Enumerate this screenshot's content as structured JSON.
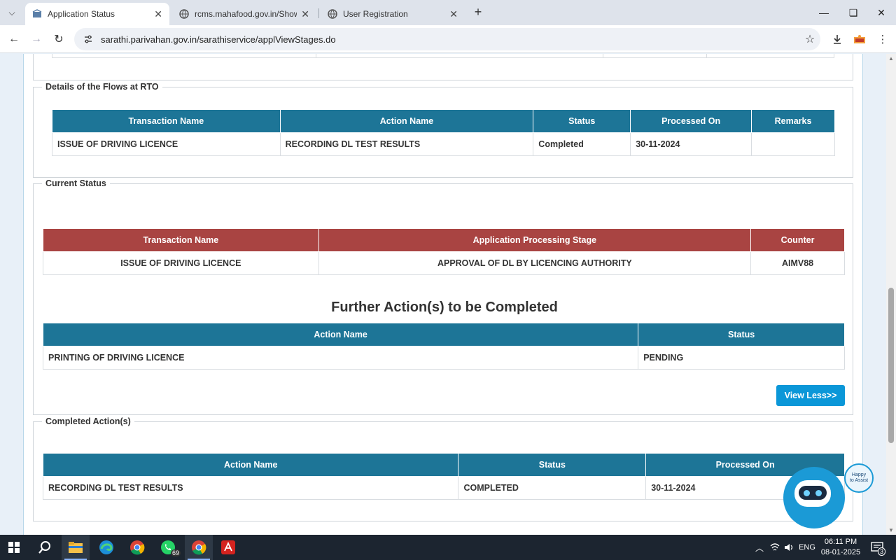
{
  "browser": {
    "tabs": [
      {
        "title": "Application Status",
        "active": true
      },
      {
        "title": "rcms.mahafood.gov.in/Show_Re",
        "active": false
      },
      {
        "title": "User Registration",
        "active": false
      }
    ],
    "url": "sarathi.parivahan.gov.in/sarathiservice/applViewStages.do"
  },
  "flows": {
    "legend": "Details of the Flows at RTO",
    "headers": [
      "Transaction Name",
      "Action Name",
      "Status",
      "Processed On",
      "Remarks"
    ],
    "rows": [
      [
        "ISSUE OF DRIVING LICENCE",
        "RECORDING DL TEST RESULTS",
        "Completed",
        "30-11-2024",
        ""
      ]
    ]
  },
  "current": {
    "legend": "Current Status",
    "headers": [
      "Transaction Name",
      "Application Processing Stage",
      "Counter"
    ],
    "rows": [
      [
        "ISSUE OF DRIVING LICENCE",
        "APPROVAL OF DL BY LICENCING AUTHORITY",
        "AIMV88"
      ]
    ],
    "further_title": "Further Action(s) to be Completed",
    "further_headers": [
      "Action Name",
      "Status"
    ],
    "further_rows": [
      [
        "PRINTING OF DRIVING LICENCE",
        "PENDING"
      ]
    ],
    "view_less": "View Less>>"
  },
  "completed": {
    "legend": "Completed Action(s)",
    "headers": [
      "Action Name",
      "Status",
      "Processed On"
    ],
    "rows": [
      [
        "RECORDING DL TEST RESULTS",
        "COMPLETED",
        "30-11-2024"
      ]
    ]
  },
  "bot": {
    "bubble_line1": "Happy",
    "bubble_line2": "to Assist"
  },
  "taskbar": {
    "whatsapp_badge": "69",
    "lang": "ENG",
    "time": "06:11 PM",
    "date": "08-01-2025",
    "notifications": "3"
  },
  "colors": {
    "teal_header": "#1d7597",
    "red_header": "#a94442",
    "button": "#0b97d8"
  }
}
